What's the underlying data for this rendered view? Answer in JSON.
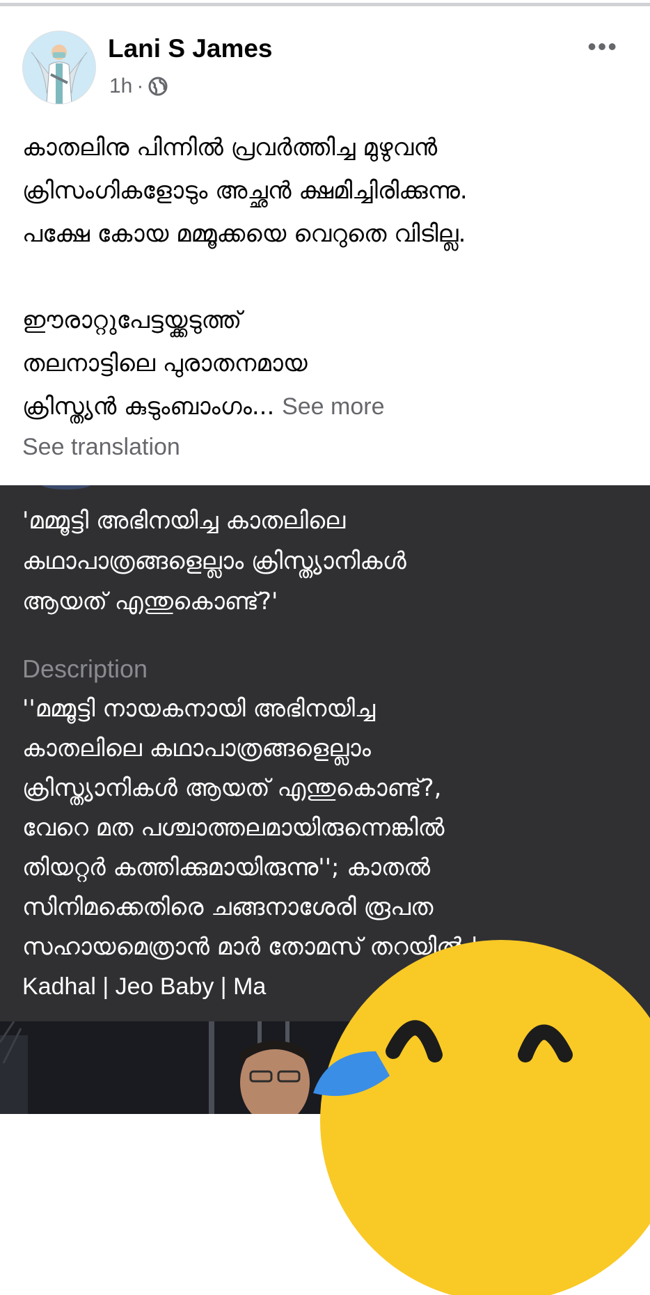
{
  "post": {
    "author": "Lani S James",
    "time": "1h",
    "separator": "·",
    "body_lines": [
      "കാതലിനു പിന്നിൽ പ്രവർത്തിച്ച മുഴുവൻ",
      "ക്രിസംഗികളോടും അച്ഛൻ ക്ഷമിച്ചിരിക്കുന്നു.",
      "പക്ഷേ കോയ മമ്മൂക്കയെ വെറുതെ വിടില്ല."
    ],
    "body_lines_2": [
      "ഈരാറ്റുപേട്ടയ്ക്കടുത്ത്",
      "തലനാട്ടിലെ പുരാതനമായ",
      " ക്രിസ്ത്യൻ കുടുംബാംഗം..."
    ],
    "see_more": "See more",
    "see_translation": "See translation"
  },
  "link_preview": {
    "headline_lines": [
      "'മമ്മൂട്ടി അഭിനയിച്ച കാതലിലെ",
      "കഥാപാത്രങ്ങളെല്ലാം ക്രിസ്ത്യാനികൾ",
      "ആയത് എന്തുകൊണ്ട്?'"
    ],
    "description_label": "Description",
    "description_lines": [
      "''മമ്മൂട്ടി നായകനായി അഭിനയിച്ച",
      "കാതലിലെ കഥാപാത്രങ്ങളെല്ലാം",
      "ക്രിസ്ത്യാനികൾ ആയത് എന്തുകൊണ്ട്?,",
      "വേറെ മത പശ്ചാത്തലമായിരുന്നെങ്കിൽ",
      "തിയറ്റർ കത്തിക്കുമായിരുന്നു''; കാതൽ",
      "സിനിമക്കെതിരെ ചങ്ങനാശേരി രൂപത",
      "സഹായമെത്രാൻ മാർ തോമസ് തറയിൽ |",
      "Kadhal  | Jeo Baby |  Ma"
    ]
  },
  "icons": {
    "avatar": "doctor-angel-avatar",
    "globe": "globe-icon",
    "more": "more-options-icon",
    "emoji": "laughing-tears-emoji"
  },
  "colors": {
    "dark_panel": "#303033",
    "muted_text": "#65676b",
    "emoji_yellow": "#f9c926",
    "tear_blue": "#3a8ee6"
  }
}
